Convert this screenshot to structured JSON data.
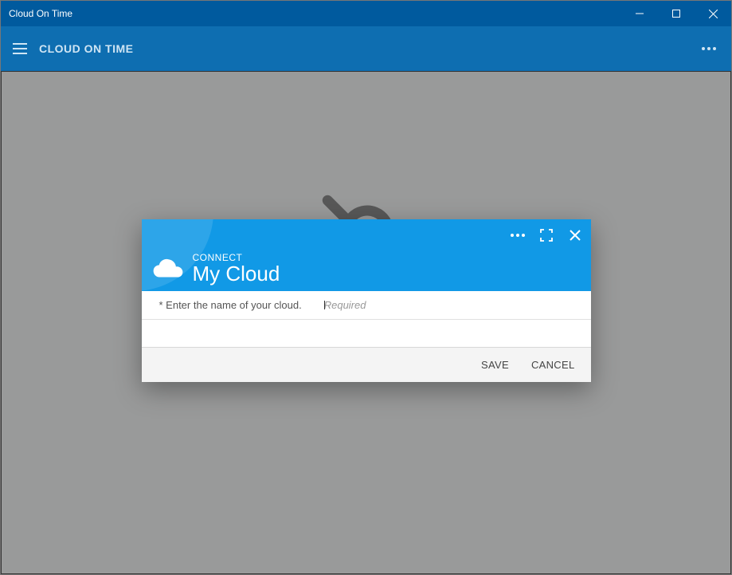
{
  "window": {
    "title": "Cloud On Time"
  },
  "appbar": {
    "title": "CLOUD ON TIME"
  },
  "dialog": {
    "subtitle": "CONNECT",
    "title": "My Cloud",
    "field_label": "* Enter the name of your cloud.",
    "placeholder": "Required",
    "save_label": "SAVE",
    "cancel_label": "CANCEL"
  }
}
